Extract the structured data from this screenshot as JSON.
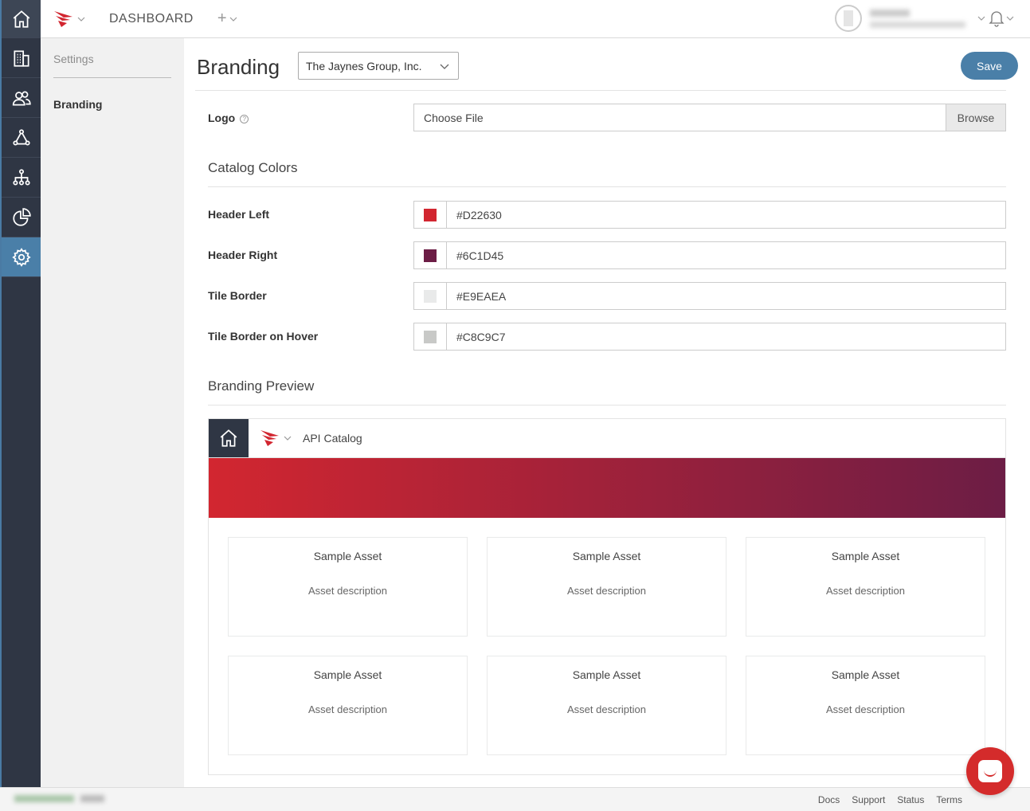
{
  "rail": {
    "items": [
      {
        "name": "home-icon"
      },
      {
        "name": "building-icon"
      },
      {
        "name": "users-icon"
      },
      {
        "name": "network-icon"
      },
      {
        "name": "hierarchy-icon"
      },
      {
        "name": "analytics-icon"
      },
      {
        "name": "settings-gear-icon",
        "active": true
      }
    ]
  },
  "topbar": {
    "dashboard_label": "DASHBOARD",
    "plus_label": "+"
  },
  "subnav": {
    "title": "Settings",
    "items": [
      {
        "label": "Branding"
      }
    ]
  },
  "main": {
    "title": "Branding",
    "org_select_value": "The Jaynes Group, Inc.",
    "save_label": "Save",
    "logo": {
      "label": "Logo",
      "help_icon": "?",
      "file_placeholder": "Choose File",
      "browse_label": "Browse"
    },
    "catalog_colors_title": "Catalog Colors",
    "colors": [
      {
        "label": "Header Left",
        "value": "#D22630",
        "swatch": "#D22630"
      },
      {
        "label": "Header Right",
        "value": "#6C1D45",
        "swatch": "#6C1D45"
      },
      {
        "label": "Tile Border",
        "value": "#E9EAEA",
        "swatch": "#E9EAEA"
      },
      {
        "label": "Tile Border on Hover",
        "value": "#C8C9C7",
        "swatch": "#C8C9C7"
      }
    ],
    "preview_title": "Branding Preview",
    "preview": {
      "catalog_title": "API Catalog",
      "tiles": [
        {
          "name": "Sample Asset",
          "description": "Asset description"
        },
        {
          "name": "Sample Asset",
          "description": "Asset description"
        },
        {
          "name": "Sample Asset",
          "description": "Asset description"
        },
        {
          "name": "Sample Asset",
          "description": "Asset description"
        },
        {
          "name": "Sample Asset",
          "description": "Asset description"
        },
        {
          "name": "Sample Asset",
          "description": "Asset description"
        }
      ]
    }
  },
  "footer": {
    "links": [
      "Docs",
      "Support",
      "Status",
      "Terms"
    ]
  },
  "colors": {
    "rail_bg": "#2F3644",
    "accent": "#4A7FA8",
    "brand_red": "#D22630",
    "brand_purple": "#6C1D45"
  }
}
